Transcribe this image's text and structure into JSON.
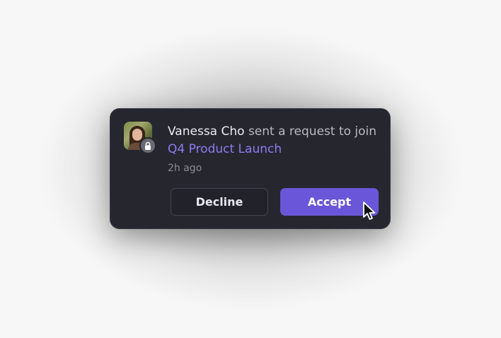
{
  "notification": {
    "requester_name": "Vanessa Cho",
    "message_part1": " sent a request to join ",
    "project_name": "Q4 Product Launch",
    "time": "2h ago",
    "avatar_icon": "person-avatar",
    "badge_icon": "lock-icon"
  },
  "actions": {
    "decline_label": "Decline",
    "accept_label": "Accept"
  },
  "colors": {
    "card_background": "#26262f",
    "accent": "#6a56d8",
    "project_link": "#8d7cf0"
  }
}
